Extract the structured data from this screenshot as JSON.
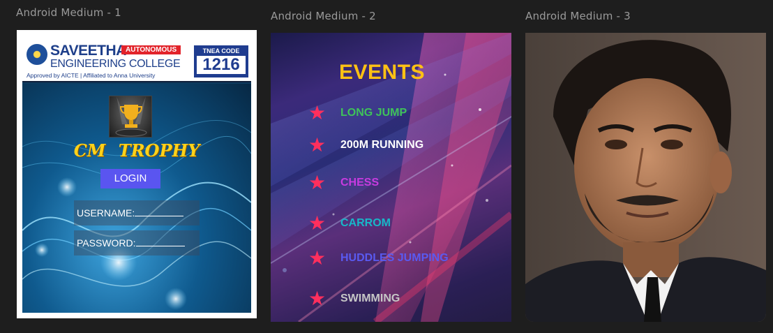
{
  "frames": [
    {
      "title": "Android Medium - 1",
      "banner": {
        "college_line1": "SAVEETHA",
        "autonomous": "AUTONOMOUS",
        "college_line2": "ENGINEERING COLLEGE",
        "approved": "Approved by AICTE  |  Affiliated to Anna University",
        "tnea_label": "TNEA CODE",
        "tnea_code": "1216"
      },
      "app_title": "CM TROPHY",
      "login_button": "LOGIN",
      "username_label": "USERNAME:",
      "password_label": "PASSWORD:"
    },
    {
      "title": "Android Medium - 2",
      "heading": "EVENTS",
      "events": [
        {
          "label": "LONG JUMP",
          "color": "#3fc25a"
        },
        {
          "label": "200M RUNNING",
          "color": "#ffffff"
        },
        {
          "label": "CHESS",
          "color": "#c83be0"
        },
        {
          "label": "CARROM",
          "color": "#18b7c9"
        },
        {
          "label": "HUDDLES JUMPING",
          "color": "#5a5af0"
        },
        {
          "label": "SWIMMING",
          "color": "#c6c6c6"
        }
      ],
      "star_icon": "star-icon"
    },
    {
      "title": "Android Medium - 3",
      "photo": "portrait-photo"
    }
  ],
  "colors": {
    "canvas_bg": "#1e1e1e",
    "frame_title": "#9a9a9a",
    "login_button": "#5a55f0",
    "cm_trophy": "#ffd21a",
    "events_heading": "#ffc114",
    "star": "#ff2f5d"
  }
}
